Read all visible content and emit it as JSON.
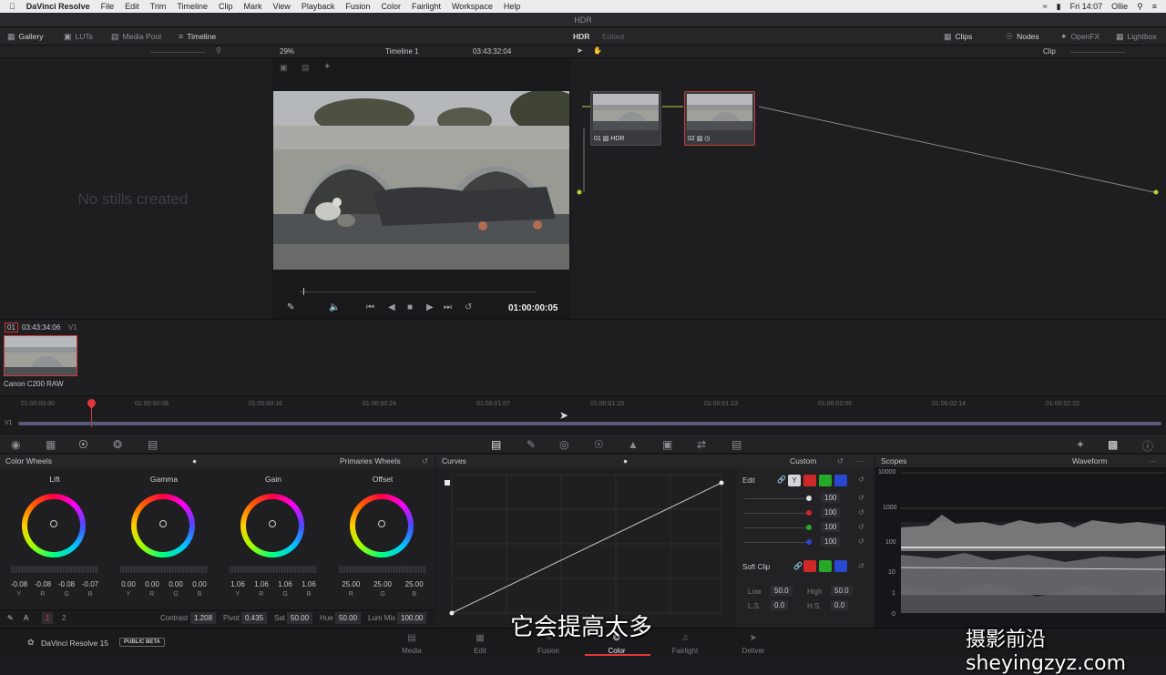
{
  "menubar": {
    "app_name": "DaVinci Resolve",
    "menus": [
      "File",
      "Edit",
      "Trim",
      "Timeline",
      "Clip",
      "Mark",
      "View",
      "Playback",
      "Fusion",
      "Color",
      "Fairlight",
      "Workspace",
      "Help"
    ],
    "clock": "Fri 14:07",
    "user": "Ollie"
  },
  "window": {
    "title": "HDR"
  },
  "toolbar": {
    "gallery": "Gallery",
    "luts": "LUTs",
    "media_pool": "Media Pool",
    "timeline": "Timeline",
    "project": "HDR",
    "project_state": "Edited",
    "clips": "Clips",
    "nodes": "Nodes",
    "openfx": "OpenFX",
    "lightbox": "Lightbox"
  },
  "viewer": {
    "zoom": "29%",
    "timeline_name": "Timeline 1",
    "source_tc": "03:43:32:04",
    "playhead_tc": "01:00:00:05",
    "node_mode": "Clip"
  },
  "gallery": {
    "empty_text": "No stills created"
  },
  "nodes": [
    {
      "num": "01",
      "label": "HDR"
    },
    {
      "num": "02",
      "label": ""
    }
  ],
  "clipstrip": {
    "clip_num": "01",
    "clip_tc": "03:43:34:06",
    "track": "V1",
    "clip_name": "Canon C200 RAW"
  },
  "ruler": {
    "ticks": [
      "01:00:00:00",
      "01:00:00:08",
      "01:00:00:16",
      "01:00:00:24",
      "01:00:01:07",
      "01:00:01:15",
      "01:00:01:23",
      "01:00:02:06",
      "01:00:02:14",
      "01:00:02:22"
    ],
    "track": "V1"
  },
  "color_wheels": {
    "title": "Color Wheels",
    "mode": "Primaries Wheels",
    "wheels": [
      {
        "name": "Lift",
        "values": [
          "-0.08",
          "-0.08",
          "-0.08",
          "-0.07"
        ],
        "channels": [
          "Y",
          "R",
          "G",
          "B"
        ]
      },
      {
        "name": "Gamma",
        "values": [
          "0.00",
          "0.00",
          "0.00",
          "0.00"
        ],
        "channels": [
          "Y",
          "R",
          "G",
          "B"
        ]
      },
      {
        "name": "Gain",
        "values": [
          "1.06",
          "1.06",
          "1.06",
          "1.06"
        ],
        "channels": [
          "Y",
          "R",
          "G",
          "B"
        ]
      },
      {
        "name": "Offset",
        "values": [
          "25.00",
          "25.00",
          "25.00"
        ],
        "channels": [
          "R",
          "G",
          "B"
        ]
      }
    ],
    "adjust": {
      "page1": "1",
      "page2": "2",
      "contrast_label": "Contrast",
      "contrast": "1.208",
      "pivot_label": "Pivot",
      "pivot": "0.435",
      "sat_label": "Sat",
      "sat": "50.00",
      "hue_label": "Hue",
      "hue": "50.00",
      "lummix_label": "Lum Mix",
      "lummix": "100.00"
    }
  },
  "curves": {
    "title": "Curves",
    "mode": "Custom",
    "edit_label": "Edit",
    "y_btn": "Y",
    "intensities": [
      "100",
      "100",
      "100",
      "100"
    ],
    "soft_clip": "Soft Clip",
    "low_label": "Low",
    "low": "50.0",
    "high_label": "High",
    "high": "50.0",
    "ls_label": "L.S.",
    "ls": "0.0",
    "hs_label": "H.S.",
    "hs": "0.0"
  },
  "scopes": {
    "title": "Scopes",
    "mode": "Waveform",
    "scale": [
      "10000",
      "1000",
      "100",
      "10",
      "1",
      "0"
    ]
  },
  "pages": [
    "Media",
    "Edit",
    "Fusion",
    "Color",
    "Fairlight",
    "Deliver"
  ],
  "footer": {
    "app": "DaVinci Resolve 15",
    "beta": "PUBLIC BETA"
  },
  "overlay": {
    "subtitle": "它会提高太多",
    "watermark": "摄影前沿 sheyingzyz.com"
  },
  "colors": {
    "accent": "#e0383b",
    "panel": "#1f1f22",
    "highlight": "#c8c8cc"
  }
}
